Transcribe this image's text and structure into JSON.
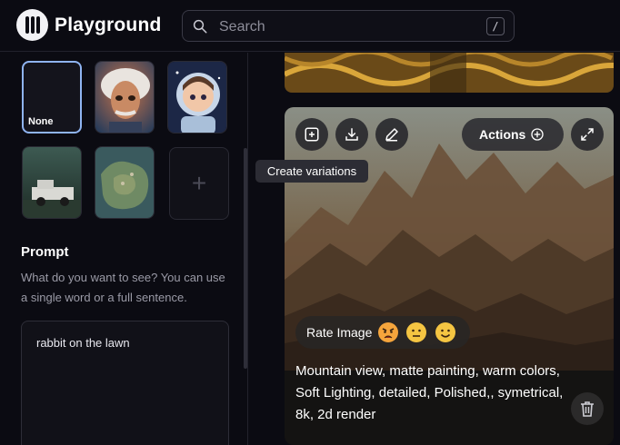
{
  "app": {
    "brand": "Playground",
    "search": {
      "placeholder": "Search",
      "shortcut": "/"
    }
  },
  "sidebar": {
    "filters": [
      {
        "label": "None",
        "selected": true
      },
      {
        "label": "",
        "image": "einstein-portrait"
      },
      {
        "label": "",
        "image": "astronaut-girl"
      },
      {
        "label": "",
        "image": "pickup-truck"
      },
      {
        "label": "",
        "image": "island-map"
      },
      {
        "label": "",
        "icon": "plus-icon"
      }
    ],
    "prompt": {
      "title": "Prompt",
      "help": "What do you want to see? You can use a single word or a full sentence.",
      "value": "rabbit on the lawn"
    }
  },
  "main": {
    "card": {
      "toolbar": {
        "actions_label": "Actions",
        "icons": [
          "add-square-icon",
          "download-icon",
          "edit-icon",
          "plus-circle-icon",
          "expand-icon"
        ]
      },
      "tooltip": "Create variations",
      "rate": {
        "label": "Rate Image",
        "emojis": [
          "angry-face-icon",
          "neutral-face-icon",
          "smile-face-icon"
        ]
      },
      "caption": "Mountain view, matte painting, warm colors, Soft Lighting, detailed, Polished,, symetrical, 8k, 2d render",
      "delete_icon": "trash-icon"
    }
  },
  "colors": {
    "background": "#0b0b12",
    "selected_border": "#8fb4f2",
    "accent_emoji": "#f5c542",
    "angry_emoji": "#f5a53c"
  }
}
